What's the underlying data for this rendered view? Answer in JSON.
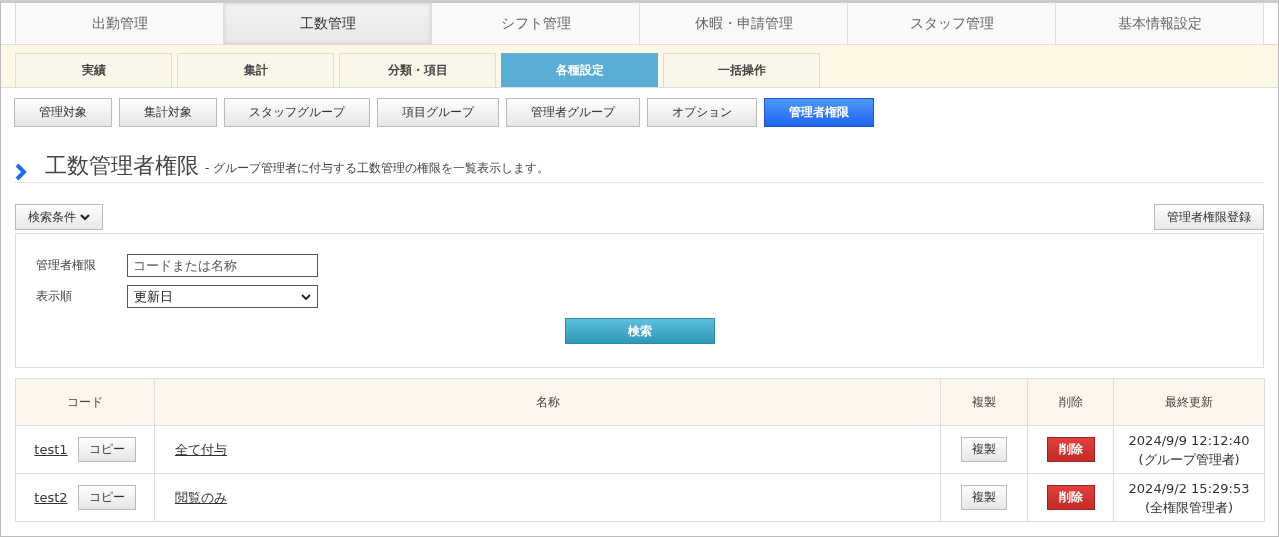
{
  "main_tabs": [
    {
      "label": "出勤管理",
      "selected": false
    },
    {
      "label": "工数管理",
      "selected": true
    },
    {
      "label": "シフト管理",
      "selected": false
    },
    {
      "label": "休暇・申請管理",
      "selected": false
    },
    {
      "label": "スタッフ管理",
      "selected": false
    },
    {
      "label": "基本情報設定",
      "selected": false
    }
  ],
  "sub_tabs": [
    {
      "label": "実績",
      "selected": false
    },
    {
      "label": "集計",
      "selected": false
    },
    {
      "label": "分類・項目",
      "selected": false
    },
    {
      "label": "各種設定",
      "selected": true
    },
    {
      "label": "一括操作",
      "selected": false
    }
  ],
  "setting_buttons": [
    {
      "label": "管理対象",
      "selected": false
    },
    {
      "label": "集計対象",
      "selected": false
    },
    {
      "label": "スタッフグループ",
      "selected": false
    },
    {
      "label": "項目グループ",
      "selected": false
    },
    {
      "label": "管理者グループ",
      "selected": false
    },
    {
      "label": "オプション",
      "selected": false
    },
    {
      "label": "管理者権限",
      "selected": true
    }
  ],
  "heading": {
    "title": "工数管理者権限",
    "description": "- グループ管理者に付与する工数管理の権限を一覧表示します。"
  },
  "search_toggle": {
    "label": "検索条件",
    "expanded": true
  },
  "register_button": "管理者権限登録",
  "search_form": {
    "fields": [
      {
        "kind": "text",
        "label": "管理者権限",
        "placeholder": "コードまたは名称"
      },
      {
        "kind": "select",
        "label": "表示順",
        "value": "更新日"
      }
    ],
    "submit": "検索"
  },
  "table": {
    "columns": [
      "コード",
      "名称",
      "複製",
      "削除",
      "最終更新"
    ],
    "rows": [
      {
        "code": "test1",
        "copy": "コピー",
        "name": "全て付与",
        "duplicate": "複製",
        "delete": "削除",
        "updated": "2024/9/9 12:12:40",
        "updated_by": "(グループ管理者)"
      },
      {
        "code": "test2",
        "copy": "コピー",
        "name": "閲覧のみ",
        "duplicate": "複製",
        "delete": "削除",
        "updated": "2024/9/2 15:29:53",
        "updated_by": "(全権限管理者)"
      }
    ]
  }
}
